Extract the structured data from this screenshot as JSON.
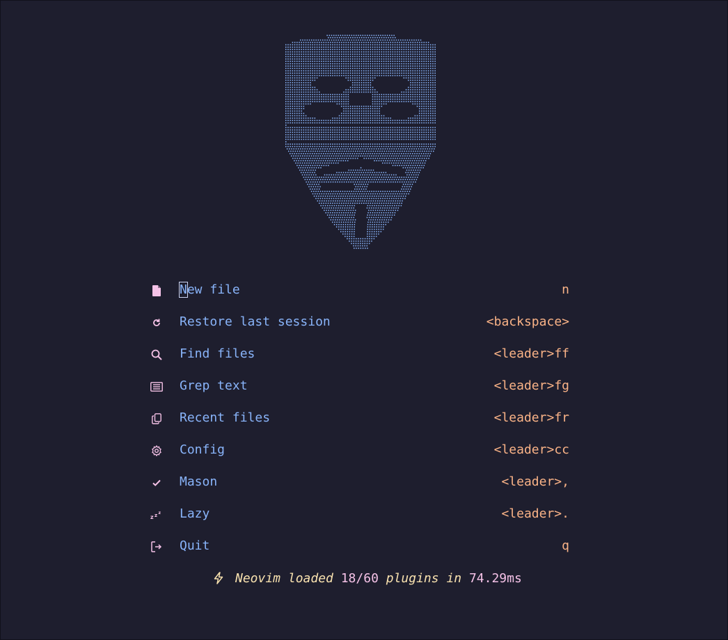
{
  "app": "Neovim dashboard",
  "colors": {
    "background": "#1e1e2e",
    "logo": "#89b4fa",
    "icon": "#f5c2e7",
    "label": "#89b4fa",
    "key": "#fab387",
    "footer": "#f9e2af"
  },
  "logo": {
    "icon": "guy-fawkes-mask-ascii-art"
  },
  "menu": {
    "items": [
      {
        "icon": "file-icon",
        "label": "New file",
        "key": "n"
      },
      {
        "icon": "restore-icon",
        "label": "Restore last session",
        "key": "<backspace>"
      },
      {
        "icon": "search-icon",
        "label": "Find files",
        "key": "<leader>ff"
      },
      {
        "icon": "grep-icon",
        "label": "Grep text",
        "key": "<leader>fg"
      },
      {
        "icon": "copy-icon",
        "label": "Recent files",
        "key": "<leader>fr"
      },
      {
        "icon": "gear-icon",
        "label": "Config",
        "key": "<leader>cc"
      },
      {
        "icon": "check-icon",
        "label": "Mason",
        "key": "<leader>,"
      },
      {
        "icon": "sleep-icon",
        "label": "Lazy",
        "key": "<leader>."
      },
      {
        "icon": "logout-icon",
        "label": "Quit",
        "key": "q"
      }
    ]
  },
  "footer": {
    "icon": "lightning-icon",
    "prefix": "Neovim loaded ",
    "loaded": "18/60",
    "middle": " plugins in ",
    "time": "74.29ms"
  }
}
